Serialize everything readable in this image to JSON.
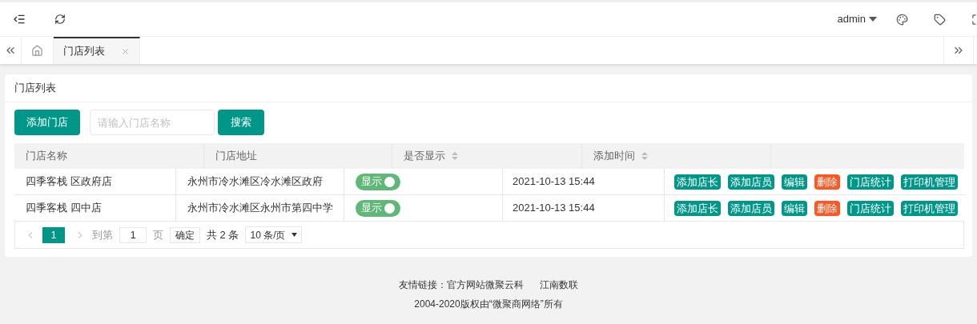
{
  "header": {
    "user": "admin"
  },
  "tabs": [
    {
      "label": "门店列表",
      "selected": true
    }
  ],
  "card": {
    "title": "门店列表",
    "add_button": "添加门店",
    "search": {
      "placeholder": "请输入门店名称"
    },
    "search_button": "搜索"
  },
  "table": {
    "columns": [
      {
        "label": "门店名称",
        "sortable": false
      },
      {
        "label": "门店地址",
        "sortable": false
      },
      {
        "label": "是否显示",
        "sortable": true
      },
      {
        "label": "添加时间",
        "sortable": true
      }
    ],
    "rows": [
      {
        "name": "四季客栈 区政府店",
        "address": "永州市冷水滩区冷水滩区政府",
        "switch": {
          "label": "显示",
          "on": true
        },
        "time": "2021-10-13 15:44",
        "actions": [
          {
            "label": "添加店长",
            "kind": "normal"
          },
          {
            "label": "添加店员",
            "kind": "normal"
          },
          {
            "label": "编辑",
            "kind": "normal"
          },
          {
            "label": "删除",
            "kind": "danger"
          },
          {
            "label": "门店统计",
            "kind": "normal"
          },
          {
            "label": "打印机管理",
            "kind": "normal"
          }
        ]
      },
      {
        "name": "四季客栈 四中店",
        "address": "永州市冷水滩区永州市第四中学",
        "switch": {
          "label": "显示",
          "on": true
        },
        "time": "2021-10-13 15:44",
        "actions": [
          {
            "label": "添加店长",
            "kind": "normal"
          },
          {
            "label": "添加店员",
            "kind": "normal"
          },
          {
            "label": "编辑",
            "kind": "normal"
          },
          {
            "label": "删除",
            "kind": "danger"
          },
          {
            "label": "门店统计",
            "kind": "normal"
          },
          {
            "label": "打印机管理",
            "kind": "normal"
          }
        ]
      }
    ]
  },
  "pagination": {
    "pages": [
      {
        "label": "1",
        "selected": true
      }
    ],
    "goto_label": "到第",
    "goto_value": "1",
    "page_unit": "页",
    "confirm": "确定",
    "total": "共 2 条",
    "page_size": "10 条/页"
  },
  "footer": {
    "links_label": "友情链接：",
    "links": [
      "官方网站微聚云科",
      "江南数联"
    ],
    "copyright": "2004-2020版权由“微聚商网络”所有"
  }
}
